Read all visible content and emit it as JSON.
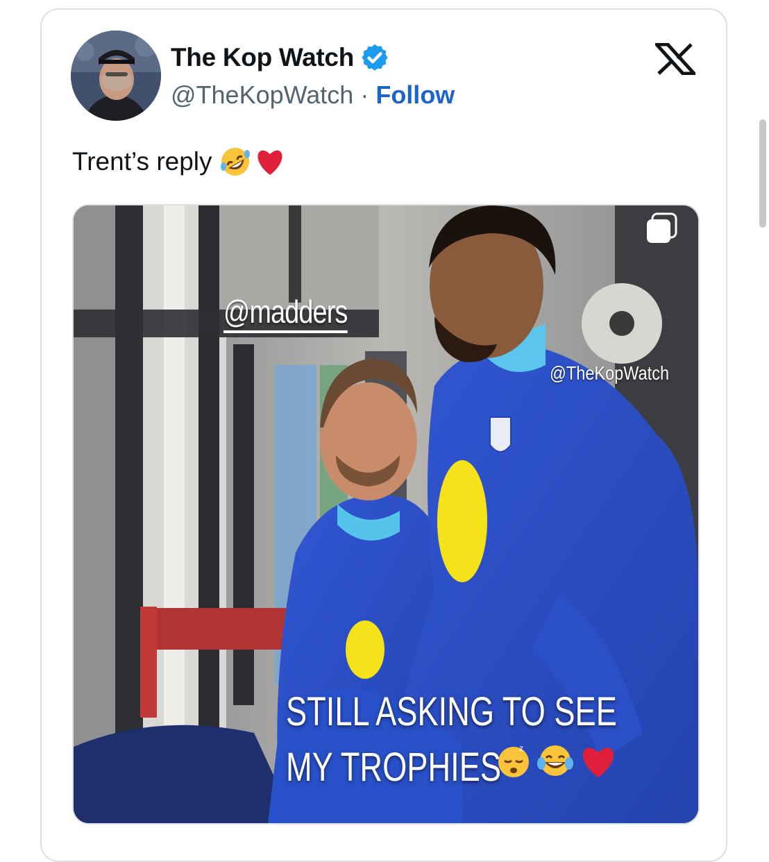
{
  "account": {
    "name": "The Kop Watch",
    "handle": "@TheKopWatch",
    "separator": " · ",
    "follow_label": "Follow",
    "verified": true
  },
  "tweet": {
    "text": "Trent’s reply",
    "emojis": [
      "rolling-on-floor-laughing",
      "red-heart"
    ]
  },
  "media": {
    "tag_text": "@madders",
    "watermark": "@TheKopWatch",
    "caption_line1": "STILL ASKING TO SEE",
    "caption_line2": "MY TROPHIES",
    "caption_emojis": [
      "sleeping-face",
      "tears-of-joy",
      "red-heart"
    ]
  },
  "colors": {
    "follow": "#1d64c7",
    "verified_badge": "#1d9bf0",
    "jersey": "#2a4fc7"
  },
  "icons": {
    "platform": "x-logo",
    "verified": "verified-badge-icon",
    "multi_image": "multiple-images-icon"
  }
}
